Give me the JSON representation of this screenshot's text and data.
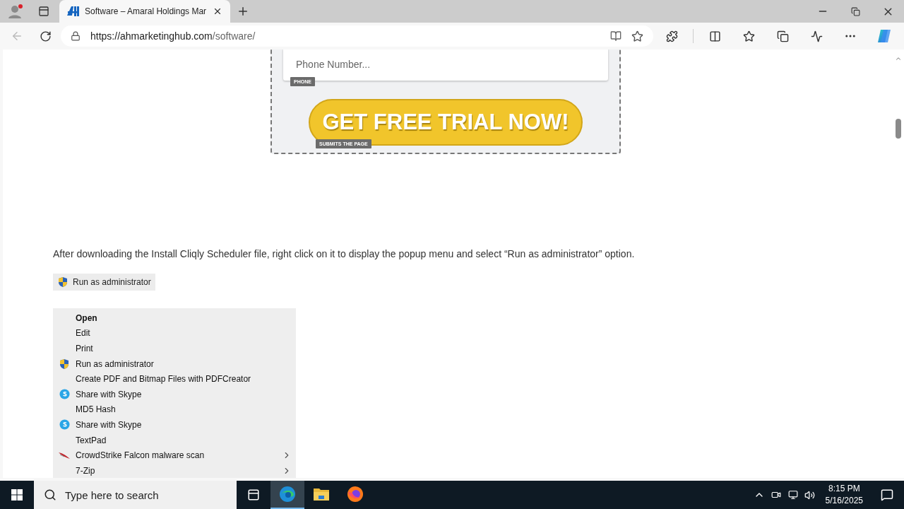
{
  "browser": {
    "tab_title": "Software – Amaral Holdings Mar",
    "url_host": "https://ahmarketinghub.com",
    "url_path": "/software/"
  },
  "form": {
    "phone_placeholder": "Phone Number...",
    "phone_tag": "PHONE",
    "cta": "GET FREE TRIAL NOW!",
    "cta_tag": "SUBMITS THE PAGE"
  },
  "instruction": "After downloading the Install Cliqly Scheduler file, right click on it to display the popup menu and select “Run as administrator” option.",
  "chip": {
    "label": "Run as administrator"
  },
  "context_menu": [
    {
      "label": "Open",
      "kind": "plain",
      "default": true,
      "submenu": false
    },
    {
      "label": "Edit",
      "kind": "plain",
      "default": false,
      "submenu": false
    },
    {
      "label": "Print",
      "kind": "plain",
      "default": false,
      "submenu": false
    },
    {
      "label": "Run as administrator",
      "kind": "shield",
      "default": false,
      "submenu": false
    },
    {
      "label": "Create PDF and Bitmap Files with PDFCreator",
      "kind": "plain",
      "default": false,
      "submenu": false
    },
    {
      "label": "Share with Skype",
      "kind": "skype",
      "default": false,
      "submenu": false
    },
    {
      "label": "MD5 Hash",
      "kind": "plain",
      "default": false,
      "submenu": false
    },
    {
      "label": "Share with Skype",
      "kind": "skype",
      "default": false,
      "submenu": false
    },
    {
      "label": "TextPad",
      "kind": "plain",
      "default": false,
      "submenu": false
    },
    {
      "label": "CrowdStrike Falcon malware scan",
      "kind": "falcon",
      "default": false,
      "submenu": true
    },
    {
      "label": "7-Zip",
      "kind": "plain",
      "default": false,
      "submenu": true
    }
  ],
  "taskbar": {
    "search_placeholder": "Type here to search",
    "apps": [
      {
        "kind": "edge",
        "selected": true
      },
      {
        "kind": "explorer",
        "selected": false
      },
      {
        "kind": "firefox",
        "selected": false
      }
    ],
    "time": "8:15 PM",
    "date": "5/16/2025"
  }
}
